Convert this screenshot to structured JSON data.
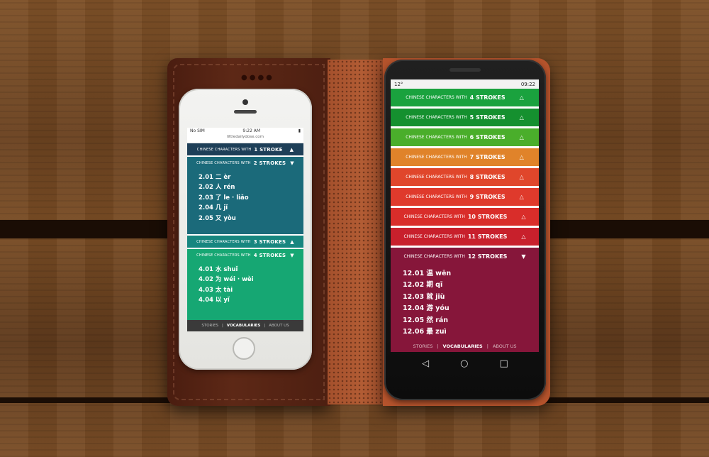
{
  "iphone": {
    "status": {
      "carrier": "No SIM",
      "time": "9:22 AM",
      "battery": "▮"
    },
    "url": "littledailydose.com",
    "header_prefix": "CHINESE CHARACTERS WITH",
    "sections": [
      {
        "strokes": "1 STROKE",
        "icon": "▲",
        "color": "#1e3f58"
      },
      {
        "strokes": "2 STROKES",
        "icon": "▼",
        "color": "#1b6a7a"
      },
      {
        "strokes": "3 STROKES",
        "icon": "▲",
        "color": "#17867f"
      },
      {
        "strokes": "4 STROKES",
        "icon": "▼",
        "color": "#16a773"
      }
    ],
    "list_2": [
      "2.01 二 èr",
      "2.02 人 rén",
      "2.03 了 le · liǎo",
      "2.04 几 jǐ",
      "2.05 又 yòu"
    ],
    "list_4": [
      "4.01 水 shuǐ",
      "4.02 为 wéi · wèi",
      "4.03 太 tài",
      "4.04 以 yǐ"
    ],
    "nav": {
      "stories": "STORIES",
      "vocab": "VOCABULARIES",
      "about": "ABOUT US",
      "sep": "|"
    }
  },
  "moto": {
    "status": {
      "left": "12°",
      "time": "09:22"
    },
    "header_prefix": "CHINESE CHARACTERS WITH",
    "sections": [
      {
        "strokes": "4 STROKES",
        "icon": "△",
        "color": "#1aa23e"
      },
      {
        "strokes": "5 STROKES",
        "icon": "△",
        "color": "#15902f"
      },
      {
        "strokes": "6 STROKES",
        "icon": "△",
        "color": "#4aae2b"
      },
      {
        "strokes": "7 STROKES",
        "icon": "△",
        "color": "#e0832a"
      },
      {
        "strokes": "8 STROKES",
        "icon": "△",
        "color": "#e0462b"
      },
      {
        "strokes": "9 STROKES",
        "icon": "△",
        "color": "#df3a2c"
      },
      {
        "strokes": "10 STROKES",
        "icon": "△",
        "color": "#d92d2a"
      },
      {
        "strokes": "11 STROKES",
        "icon": "△",
        "color": "#c8202c"
      },
      {
        "strokes": "12 STROKES",
        "icon": "▼",
        "color": "#86163a"
      }
    ],
    "list_12": [
      "12.01 温 wēn",
      "12.02 期 qī",
      "12.03 就 jiù",
      "12.04 游 yóu",
      "12.05 然 rán",
      "12.06 最 zuì"
    ],
    "nav": {
      "stories": "STORIES",
      "vocab": "VOCABULARIES",
      "about": "ABOUT US",
      "sep": "|"
    },
    "softkeys": {
      "back": "◁",
      "home": "○",
      "recent": "□"
    }
  }
}
